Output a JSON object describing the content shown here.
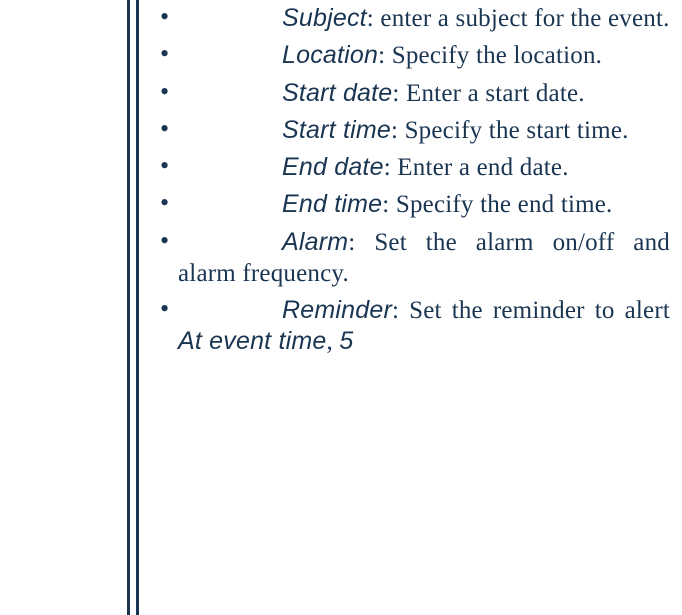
{
  "items": [
    {
      "term": "Subject",
      "desc": ": enter a subject for the event."
    },
    {
      "term": "Location",
      "desc": ": Specify the location."
    },
    {
      "term": "Start date",
      "desc": ": Enter a start date."
    },
    {
      "term": "Start time",
      "desc": ": Specify the start time."
    },
    {
      "term": "End date",
      "desc": ": Enter a end date."
    },
    {
      "term": "End time",
      "desc": ": Specify the end time."
    },
    {
      "term": "Alarm",
      "desc": ": Set the alarm on/off and alarm frequency."
    }
  ],
  "reminder": {
    "term": "Reminder",
    "desc_prefix": ": Set the reminder to alert ",
    "inline1": "At event time",
    "comma": ", ",
    "inline2": "5"
  }
}
